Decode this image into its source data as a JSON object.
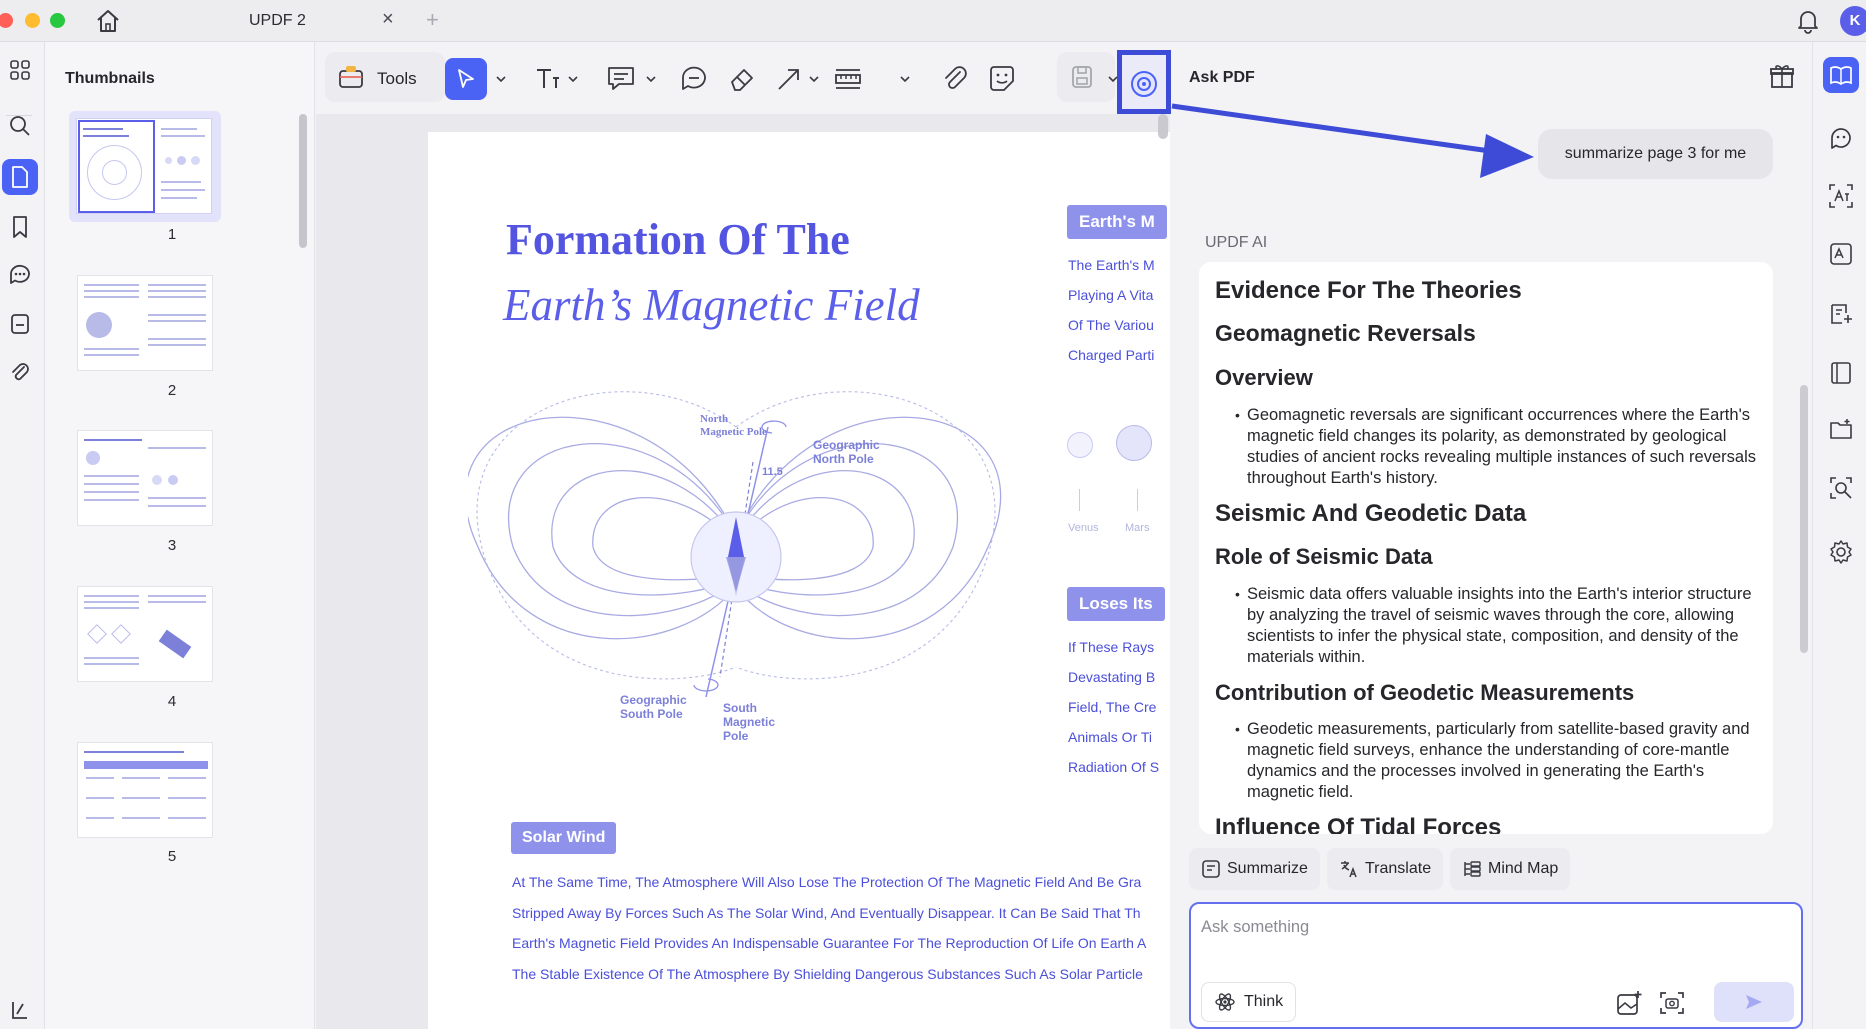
{
  "window": {
    "tab_title": "UPDF 2",
    "tab_close": "×",
    "new_tab": "+",
    "avatar_initial": "K"
  },
  "thumbnails": {
    "title": "Thumbnails",
    "pages": [
      "1",
      "2",
      "3",
      "4",
      "5"
    ],
    "selected": "1"
  },
  "toolbar": {
    "tools_label": "Tools",
    "ask_pdf_label": "Ask PDF",
    "icons": [
      "tools-icon",
      "select-cursor-icon",
      "text-icon",
      "comment-icon",
      "chat-bubble-icon",
      "eraser-icon",
      "arrow-line-icon",
      "ruler-icon",
      "attachment-icon",
      "sticker-icon",
      "save-icon",
      "ask-pdf-ai-icon",
      "gift-icon"
    ]
  },
  "document": {
    "title_line1": "Formation Of The",
    "title_line2": "Earth’s Magnetic Field",
    "badge_right_top": "Earth's M",
    "right_lines_top": [
      "The Earth's M",
      "Playing A Vita",
      "Of The Variou",
      "Charged Parti"
    ],
    "badge_right_mid": "Loses Its",
    "right_lines_mid": [
      "If These Rays",
      "Devastating B",
      "Field, The Cre",
      "Animals Or Ti",
      "Radiation Of S"
    ],
    "planet_labels": [
      "Venus",
      "Mars"
    ],
    "diagram_labels": {
      "north_magnetic": "North\nMagnetic Pole",
      "geographic_north": "Geographic\nNorth Pole",
      "angle": "11.5",
      "geographic_south": "Geographic\nSouth Pole",
      "south_magnetic": "South\nMagnetic\nPole"
    },
    "solar_badge": "Solar Wind",
    "body_lines": [
      "At The Same Time, The Atmosphere Will Also Lose The Protection Of The Magnetic Field And Be Gra",
      "Stripped Away By Forces Such As The Solar Wind, And Eventually Disappear. It Can Be Said That Th",
      "Earth's Magnetic Field Provides An Indispensable Guarantee For The Reproduction Of Life On Earth A",
      "The Stable Existence Of The Atmosphere By Shielding Dangerous Substances Such As Solar Particle"
    ]
  },
  "ai": {
    "user_message": "summarize page 3 for me",
    "assistant_label": "UPDF AI",
    "response": {
      "h1_a": "Evidence For The Theories",
      "h1_b": "Geomagnetic Reversals",
      "overview": "Overview",
      "overview_bullet": "Geomagnetic reversals are significant occurrences where the Earth's magnetic field changes its polarity, as demonstrated by geological studies of ancient rocks revealing multiple instances of such reversals throughout Earth's history.",
      "h1_c": "Seismic And Geodetic Data",
      "seismic_role": "Role of Seismic Data",
      "seismic_bullet": "Seismic data offers valuable insights into the Earth's interior structure by analyzing the travel of seismic waves through the core, allowing scientists to infer the physical state, composition, and density of the materials within.",
      "geodetic": "Contribution of Geodetic Measurements",
      "geodetic_bullet": "Geodetic measurements, particularly from satellite-based gravity and magnetic field surveys, enhance the understanding of core-mantle dynamics and the processes involved in generating the Earth's magnetic field.",
      "h1_d": "Influence Of Tidal Forces"
    },
    "chips": [
      "Summarize",
      "Translate",
      "Mind Map"
    ],
    "input_placeholder": "Ask something",
    "think_label": "Think"
  },
  "colors": {
    "accent": "#4b63f5",
    "highlight_border": "#3e4bd6",
    "doc_purple": "#5355e0"
  }
}
